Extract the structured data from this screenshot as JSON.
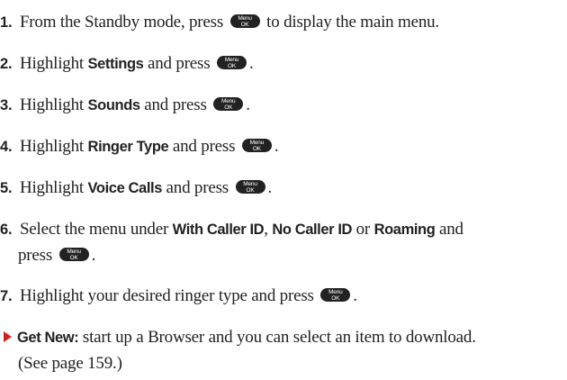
{
  "key_label_top": "Menu",
  "key_label_bottom": "OK",
  "steps": [
    {
      "num": "1.",
      "text1": "From the Standby mode, press",
      "text2": "to display the main menu."
    },
    {
      "num": "2.",
      "text1": "Highlight",
      "bold": "Settings",
      "text2": "and press",
      "end": "."
    },
    {
      "num": "3.",
      "text1": "Highlight",
      "bold": "Sounds",
      "text2": "and press",
      "end": "."
    },
    {
      "num": "4.",
      "text1": "Highlight",
      "bold": "Ringer Type",
      "text2": "and press",
      "end": "."
    },
    {
      "num": "5.",
      "text1": "Highlight",
      "bold": "Voice Calls",
      "text2": "and press",
      "end": "."
    },
    {
      "num": "6.",
      "text1": "Select the menu under",
      "bold1": "With Caller ID",
      "sep1": ",",
      "bold2": "No Caller ID",
      "sep2": "or",
      "bold3": "Roaming",
      "sep3": "and",
      "line2": "press",
      "end": "."
    },
    {
      "num": "7.",
      "text1": "Highlight your desired ringer type and press",
      "end": "."
    }
  ],
  "bullet": {
    "bold": "Get New:",
    "text": "start up a Browser and you can select an item to download.",
    "line2": "(See page 159.)"
  }
}
